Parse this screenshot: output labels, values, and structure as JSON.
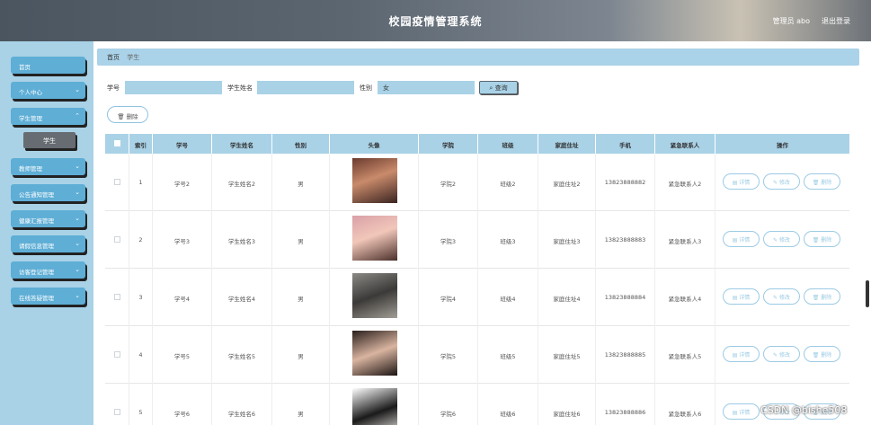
{
  "header": {
    "title": "校园疫情管理系统",
    "user": "管理员 abo",
    "logout": "退出登录"
  },
  "sidebar": {
    "items": [
      {
        "label": "首页"
      },
      {
        "label": "个人中心"
      },
      {
        "label": "学生管理"
      },
      {
        "label": "教师管理"
      },
      {
        "label": "公告通知管理"
      },
      {
        "label": "健康汇报管理"
      },
      {
        "label": "请假信息管理"
      },
      {
        "label": "访客登记管理"
      },
      {
        "label": "在线答疑管理"
      }
    ],
    "submenu": {
      "label": "学生"
    }
  },
  "breadcrumb": {
    "home": "首页",
    "current": "学生"
  },
  "search": {
    "student_no_label": "学号",
    "student_no_value": "",
    "student_name_label": "学生姓名",
    "student_name_value": "",
    "gender_label": "性别",
    "gender_value": "女",
    "query_label": "查询"
  },
  "actions": {
    "delete_label": "删除"
  },
  "table": {
    "headers": [
      "索引",
      "学号",
      "学生姓名",
      "性别",
      "头像",
      "学院",
      "班级",
      "家庭住址",
      "手机",
      "紧急联系人",
      "操作"
    ],
    "rows": [
      {
        "index": "1",
        "no": "学号2",
        "name": "学生姓名2",
        "gender": "男",
        "college": "学院2",
        "class": "班级2",
        "address": "家庭住址2",
        "phone": "13823888882",
        "contact": "紧急联系人2"
      },
      {
        "index": "2",
        "no": "学号3",
        "name": "学生姓名3",
        "gender": "男",
        "college": "学院3",
        "class": "班级3",
        "address": "家庭住址3",
        "phone": "13823888883",
        "contact": "紧急联系人3"
      },
      {
        "index": "3",
        "no": "学号4",
        "name": "学生姓名4",
        "gender": "男",
        "college": "学院4",
        "class": "班级4",
        "address": "家庭住址4",
        "phone": "13823888884",
        "contact": "紧急联系人4"
      },
      {
        "index": "4",
        "no": "学号5",
        "name": "学生姓名5",
        "gender": "男",
        "college": "学院5",
        "class": "班级5",
        "address": "家庭住址5",
        "phone": "13823888885",
        "contact": "紧急联系人5"
      },
      {
        "index": "5",
        "no": "学号6",
        "name": "学生姓名6",
        "gender": "男",
        "college": "学院6",
        "class": "班级6",
        "address": "家庭住址6",
        "phone": "13823888886",
        "contact": "紧急联系人6"
      }
    ],
    "ops": {
      "detail": "详情",
      "edit": "修改",
      "delete": "删除"
    }
  },
  "watermark": "CSDN @bishe508",
  "colors": {
    "accent": "#a9d2e7",
    "menu": "#5eaed6",
    "submenu": "#666c72"
  }
}
